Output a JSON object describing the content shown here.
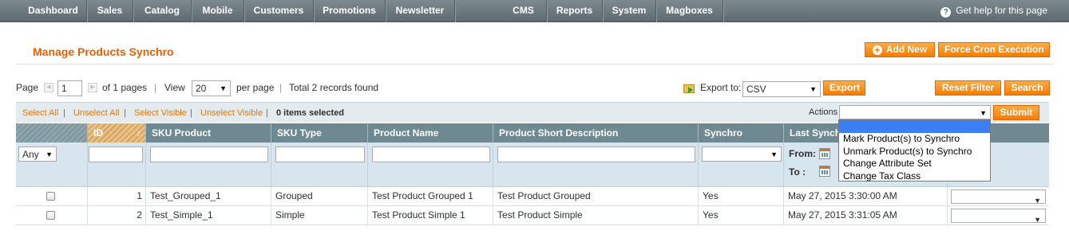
{
  "nav": {
    "items": [
      "Dashboard",
      "Sales",
      "Catalog",
      "Mobile",
      "Customers",
      "Promotions",
      "Newsletter",
      "CMS",
      "Reports",
      "System",
      "Magboxes"
    ],
    "help": "Get help for this page"
  },
  "header": {
    "title": "Manage Products Synchro",
    "add_new": "Add New",
    "force_cron": "Force Cron Execution"
  },
  "pager": {
    "page_label": "Page",
    "page_value": "1",
    "of_pages": "of 1 pages",
    "view_label": "View",
    "view_value": "20",
    "per_page": "per page",
    "total": "Total 2 records found",
    "export_label": "Export to:",
    "export_value": "CSV",
    "export_button": "Export",
    "reset_filter": "Reset Filter",
    "search": "Search"
  },
  "massaction": {
    "select_all": "Select All",
    "unselect_all": "Unselect All",
    "select_visible": "Select Visible",
    "unselect_visible": "Unselect Visible",
    "selected": "0 items selected",
    "actions_label": "Actions",
    "submit": "Submit",
    "options": [
      "Mark Product(s) to Synchro",
      "Unmark Product(s) to Synchro",
      "Change Attribute Set",
      "Change Tax Class"
    ]
  },
  "grid": {
    "columns": [
      "ID",
      "SKU Product",
      "SKU Type",
      "Product Name",
      "Product Short Description",
      "Synchro",
      "Last Synchr"
    ],
    "filters": {
      "any": "Any",
      "from": "From:",
      "to": "To :"
    },
    "rows": [
      {
        "id": "1",
        "sku": "Test_Grouped_1",
        "type": "Grouped",
        "name": "Test Product Grouped 1",
        "short_desc": "Test Product Grouped",
        "synchro": "Yes",
        "last_sync": "May 27, 2015 3:30:00 AM"
      },
      {
        "id": "2",
        "sku": "Test_Simple_1",
        "type": "Simple",
        "name": "Test Product Simple 1",
        "short_desc": "Test Product Simple",
        "synchro": "Yes",
        "last_sync": "May 27, 2015 3:31:05 AM"
      }
    ]
  },
  "colors": {
    "accent": "#eb5e00",
    "nav_bg": "#6b777d",
    "grid_header": "#6f8992",
    "filter_row": "#d7e5ef"
  }
}
